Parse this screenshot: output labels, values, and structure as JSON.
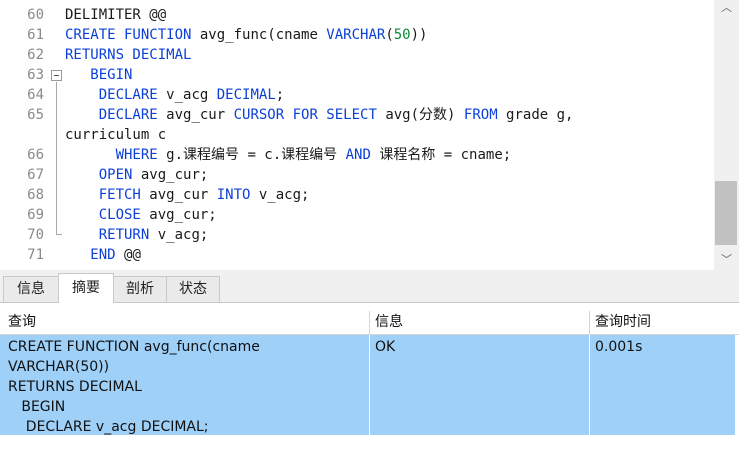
{
  "editor": {
    "lines": [
      {
        "num": "60",
        "segments": [
          {
            "t": "DELIMITER @@",
            "c": "plain"
          }
        ]
      },
      {
        "num": "61",
        "segments": [
          {
            "t": "CREATE FUNCTION",
            "c": "kw"
          },
          {
            "t": " avg_func(cname ",
            "c": "plain"
          },
          {
            "t": "VARCHAR",
            "c": "kw"
          },
          {
            "t": "(",
            "c": "plain"
          },
          {
            "t": "50",
            "c": "num"
          },
          {
            "t": "))",
            "c": "plain"
          }
        ]
      },
      {
        "num": "62",
        "segments": [
          {
            "t": "RETURNS DECIMAL",
            "c": "kw"
          }
        ]
      },
      {
        "num": "63",
        "segments": [
          {
            "t": "   ",
            "c": "plain"
          },
          {
            "t": "BEGIN",
            "c": "kw"
          }
        ]
      },
      {
        "num": "64",
        "segments": [
          {
            "t": "    ",
            "c": "plain"
          },
          {
            "t": "DECLARE",
            "c": "kw"
          },
          {
            "t": " v_acg ",
            "c": "plain"
          },
          {
            "t": "DECIMAL",
            "c": "kw"
          },
          {
            "t": ";",
            "c": "plain"
          }
        ]
      },
      {
        "num": "65",
        "segments": [
          {
            "t": "    ",
            "c": "plain"
          },
          {
            "t": "DECLARE",
            "c": "kw"
          },
          {
            "t": " avg_cur ",
            "c": "plain"
          },
          {
            "t": "CURSOR FOR SELECT",
            "c": "kw"
          },
          {
            "t": " avg(分数) ",
            "c": "plain"
          },
          {
            "t": "FROM",
            "c": "kw"
          },
          {
            "t": " grade g,",
            "c": "plain"
          }
        ]
      },
      {
        "num": "",
        "segments": [
          {
            "t": "curriculum c",
            "c": "plain"
          }
        ]
      },
      {
        "num": "66",
        "segments": [
          {
            "t": "      ",
            "c": "plain"
          },
          {
            "t": "WHERE",
            "c": "kw"
          },
          {
            "t": " g.课程编号 = c.课程编号 ",
            "c": "plain"
          },
          {
            "t": "AND",
            "c": "kw"
          },
          {
            "t": " 课程名称 = cname;",
            "c": "plain"
          }
        ]
      },
      {
        "num": "67",
        "segments": [
          {
            "t": "    ",
            "c": "plain"
          },
          {
            "t": "OPEN",
            "c": "kw"
          },
          {
            "t": " avg_cur;",
            "c": "plain"
          }
        ]
      },
      {
        "num": "68",
        "segments": [
          {
            "t": "    ",
            "c": "plain"
          },
          {
            "t": "FETCH",
            "c": "kw"
          },
          {
            "t": " avg_cur ",
            "c": "plain"
          },
          {
            "t": "INTO",
            "c": "kw"
          },
          {
            "t": " v_acg;",
            "c": "plain"
          }
        ]
      },
      {
        "num": "69",
        "segments": [
          {
            "t": "    ",
            "c": "plain"
          },
          {
            "t": "CLOSE",
            "c": "kw"
          },
          {
            "t": " avg_cur;",
            "c": "plain"
          }
        ]
      },
      {
        "num": "70",
        "segments": [
          {
            "t": "    ",
            "c": "plain"
          },
          {
            "t": "RETURN",
            "c": "kw"
          },
          {
            "t": " v_acg;",
            "c": "plain"
          }
        ]
      },
      {
        "num": "71",
        "segments": [
          {
            "t": "   ",
            "c": "plain"
          },
          {
            "t": "END",
            "c": "kw"
          },
          {
            "t": " @@",
            "c": "plain"
          }
        ]
      }
    ],
    "colors": {
      "keyword": "#0b3fd8",
      "number": "#0a8a3a",
      "plain": "#1a1a1a",
      "line_number": "#8a8a8a"
    }
  },
  "scroll": {
    "up_icon": "chevron-up-icon",
    "down_icon": "chevron-down-icon",
    "up_glyph": "︿",
    "down_glyph": "﹀"
  },
  "tabs": [
    {
      "label": "信息",
      "active": false
    },
    {
      "label": "摘要",
      "active": true
    },
    {
      "label": "剖析",
      "active": false
    },
    {
      "label": "状态",
      "active": false
    }
  ],
  "results": {
    "columns": [
      "查询",
      "信息",
      "查询时间"
    ],
    "rows": [
      {
        "query": "CREATE FUNCTION avg_func(cname\nVARCHAR(50))\nRETURNS DECIMAL\n   BEGIN\n    DECLARE v_acg DECIMAL;",
        "info": "OK",
        "time": "0.001s"
      }
    ],
    "selected_color": "#9fd0f8"
  }
}
